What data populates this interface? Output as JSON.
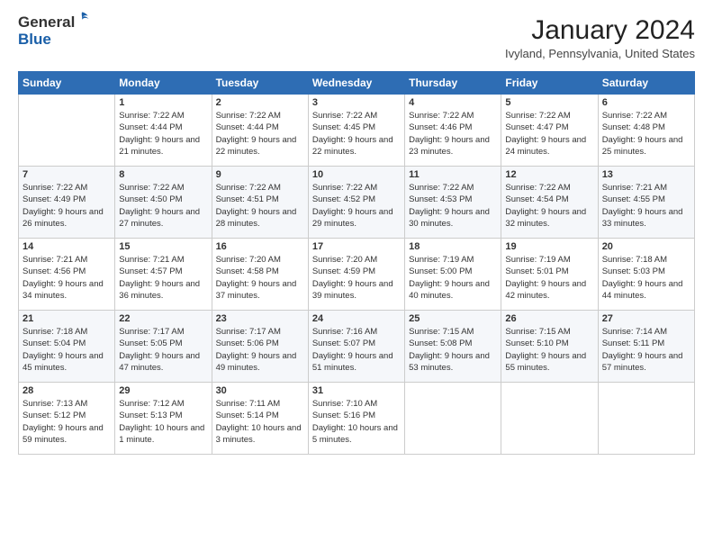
{
  "header": {
    "logo_general": "General",
    "logo_blue": "Blue",
    "month_title": "January 2024",
    "location": "Ivyland, Pennsylvania, United States"
  },
  "weekdays": [
    "Sunday",
    "Monday",
    "Tuesday",
    "Wednesday",
    "Thursday",
    "Friday",
    "Saturday"
  ],
  "weeks": [
    [
      {
        "day": "",
        "sunrise": "",
        "sunset": "",
        "daylight": ""
      },
      {
        "day": "1",
        "sunrise": "Sunrise: 7:22 AM",
        "sunset": "Sunset: 4:44 PM",
        "daylight": "Daylight: 9 hours and 21 minutes."
      },
      {
        "day": "2",
        "sunrise": "Sunrise: 7:22 AM",
        "sunset": "Sunset: 4:44 PM",
        "daylight": "Daylight: 9 hours and 22 minutes."
      },
      {
        "day": "3",
        "sunrise": "Sunrise: 7:22 AM",
        "sunset": "Sunset: 4:45 PM",
        "daylight": "Daylight: 9 hours and 22 minutes."
      },
      {
        "day": "4",
        "sunrise": "Sunrise: 7:22 AM",
        "sunset": "Sunset: 4:46 PM",
        "daylight": "Daylight: 9 hours and 23 minutes."
      },
      {
        "day": "5",
        "sunrise": "Sunrise: 7:22 AM",
        "sunset": "Sunset: 4:47 PM",
        "daylight": "Daylight: 9 hours and 24 minutes."
      },
      {
        "day": "6",
        "sunrise": "Sunrise: 7:22 AM",
        "sunset": "Sunset: 4:48 PM",
        "daylight": "Daylight: 9 hours and 25 minutes."
      }
    ],
    [
      {
        "day": "7",
        "sunrise": "Sunrise: 7:22 AM",
        "sunset": "Sunset: 4:49 PM",
        "daylight": "Daylight: 9 hours and 26 minutes."
      },
      {
        "day": "8",
        "sunrise": "Sunrise: 7:22 AM",
        "sunset": "Sunset: 4:50 PM",
        "daylight": "Daylight: 9 hours and 27 minutes."
      },
      {
        "day": "9",
        "sunrise": "Sunrise: 7:22 AM",
        "sunset": "Sunset: 4:51 PM",
        "daylight": "Daylight: 9 hours and 28 minutes."
      },
      {
        "day": "10",
        "sunrise": "Sunrise: 7:22 AM",
        "sunset": "Sunset: 4:52 PM",
        "daylight": "Daylight: 9 hours and 29 minutes."
      },
      {
        "day": "11",
        "sunrise": "Sunrise: 7:22 AM",
        "sunset": "Sunset: 4:53 PM",
        "daylight": "Daylight: 9 hours and 30 minutes."
      },
      {
        "day": "12",
        "sunrise": "Sunrise: 7:22 AM",
        "sunset": "Sunset: 4:54 PM",
        "daylight": "Daylight: 9 hours and 32 minutes."
      },
      {
        "day": "13",
        "sunrise": "Sunrise: 7:21 AM",
        "sunset": "Sunset: 4:55 PM",
        "daylight": "Daylight: 9 hours and 33 minutes."
      }
    ],
    [
      {
        "day": "14",
        "sunrise": "Sunrise: 7:21 AM",
        "sunset": "Sunset: 4:56 PM",
        "daylight": "Daylight: 9 hours and 34 minutes."
      },
      {
        "day": "15",
        "sunrise": "Sunrise: 7:21 AM",
        "sunset": "Sunset: 4:57 PM",
        "daylight": "Daylight: 9 hours and 36 minutes."
      },
      {
        "day": "16",
        "sunrise": "Sunrise: 7:20 AM",
        "sunset": "Sunset: 4:58 PM",
        "daylight": "Daylight: 9 hours and 37 minutes."
      },
      {
        "day": "17",
        "sunrise": "Sunrise: 7:20 AM",
        "sunset": "Sunset: 4:59 PM",
        "daylight": "Daylight: 9 hours and 39 minutes."
      },
      {
        "day": "18",
        "sunrise": "Sunrise: 7:19 AM",
        "sunset": "Sunset: 5:00 PM",
        "daylight": "Daylight: 9 hours and 40 minutes."
      },
      {
        "day": "19",
        "sunrise": "Sunrise: 7:19 AM",
        "sunset": "Sunset: 5:01 PM",
        "daylight": "Daylight: 9 hours and 42 minutes."
      },
      {
        "day": "20",
        "sunrise": "Sunrise: 7:18 AM",
        "sunset": "Sunset: 5:03 PM",
        "daylight": "Daylight: 9 hours and 44 minutes."
      }
    ],
    [
      {
        "day": "21",
        "sunrise": "Sunrise: 7:18 AM",
        "sunset": "Sunset: 5:04 PM",
        "daylight": "Daylight: 9 hours and 45 minutes."
      },
      {
        "day": "22",
        "sunrise": "Sunrise: 7:17 AM",
        "sunset": "Sunset: 5:05 PM",
        "daylight": "Daylight: 9 hours and 47 minutes."
      },
      {
        "day": "23",
        "sunrise": "Sunrise: 7:17 AM",
        "sunset": "Sunset: 5:06 PM",
        "daylight": "Daylight: 9 hours and 49 minutes."
      },
      {
        "day": "24",
        "sunrise": "Sunrise: 7:16 AM",
        "sunset": "Sunset: 5:07 PM",
        "daylight": "Daylight: 9 hours and 51 minutes."
      },
      {
        "day": "25",
        "sunrise": "Sunrise: 7:15 AM",
        "sunset": "Sunset: 5:08 PM",
        "daylight": "Daylight: 9 hours and 53 minutes."
      },
      {
        "day": "26",
        "sunrise": "Sunrise: 7:15 AM",
        "sunset": "Sunset: 5:10 PM",
        "daylight": "Daylight: 9 hours and 55 minutes."
      },
      {
        "day": "27",
        "sunrise": "Sunrise: 7:14 AM",
        "sunset": "Sunset: 5:11 PM",
        "daylight": "Daylight: 9 hours and 57 minutes."
      }
    ],
    [
      {
        "day": "28",
        "sunrise": "Sunrise: 7:13 AM",
        "sunset": "Sunset: 5:12 PM",
        "daylight": "Daylight: 9 hours and 59 minutes."
      },
      {
        "day": "29",
        "sunrise": "Sunrise: 7:12 AM",
        "sunset": "Sunset: 5:13 PM",
        "daylight": "Daylight: 10 hours and 1 minute."
      },
      {
        "day": "30",
        "sunrise": "Sunrise: 7:11 AM",
        "sunset": "Sunset: 5:14 PM",
        "daylight": "Daylight: 10 hours and 3 minutes."
      },
      {
        "day": "31",
        "sunrise": "Sunrise: 7:10 AM",
        "sunset": "Sunset: 5:16 PM",
        "daylight": "Daylight: 10 hours and 5 minutes."
      },
      {
        "day": "",
        "sunrise": "",
        "sunset": "",
        "daylight": ""
      },
      {
        "day": "",
        "sunrise": "",
        "sunset": "",
        "daylight": ""
      },
      {
        "day": "",
        "sunrise": "",
        "sunset": "",
        "daylight": ""
      }
    ]
  ]
}
